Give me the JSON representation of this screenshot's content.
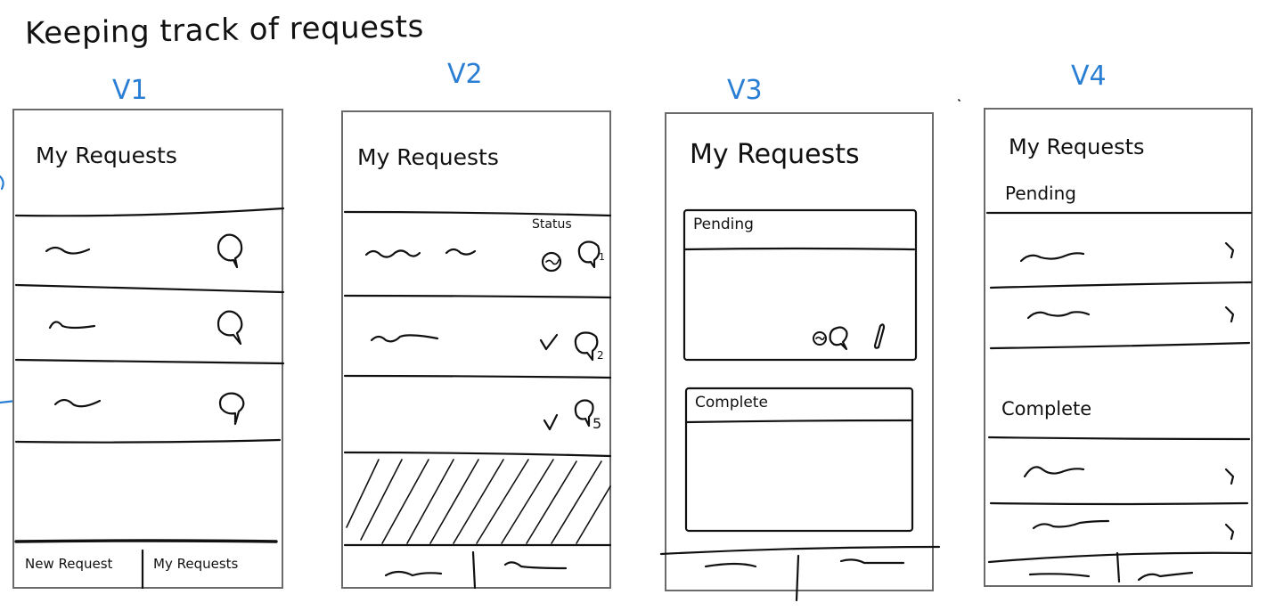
{
  "page": {
    "title": "Keeping track of requests"
  },
  "versions": [
    {
      "id": "v1",
      "label": "V1",
      "screen_title": "My Requests",
      "tabs": [
        "New Request",
        "My Requests"
      ]
    },
    {
      "id": "v2",
      "label": "V2",
      "screen_title": "My Requests",
      "status_label": "Status",
      "comment_counts": [
        "1",
        "2",
        "5"
      ]
    },
    {
      "id": "v3",
      "label": "V3",
      "screen_title": "My Requests",
      "sections": [
        "Pending",
        "Complete"
      ]
    },
    {
      "id": "v4",
      "label": "V4",
      "screen_title": "My Requests",
      "sections": [
        "Pending",
        "Complete"
      ],
      "chevron": ">"
    }
  ],
  "colors": {
    "ink": "#111111",
    "annotation": "#2a7fd4",
    "frame": "#6a6a6a"
  }
}
